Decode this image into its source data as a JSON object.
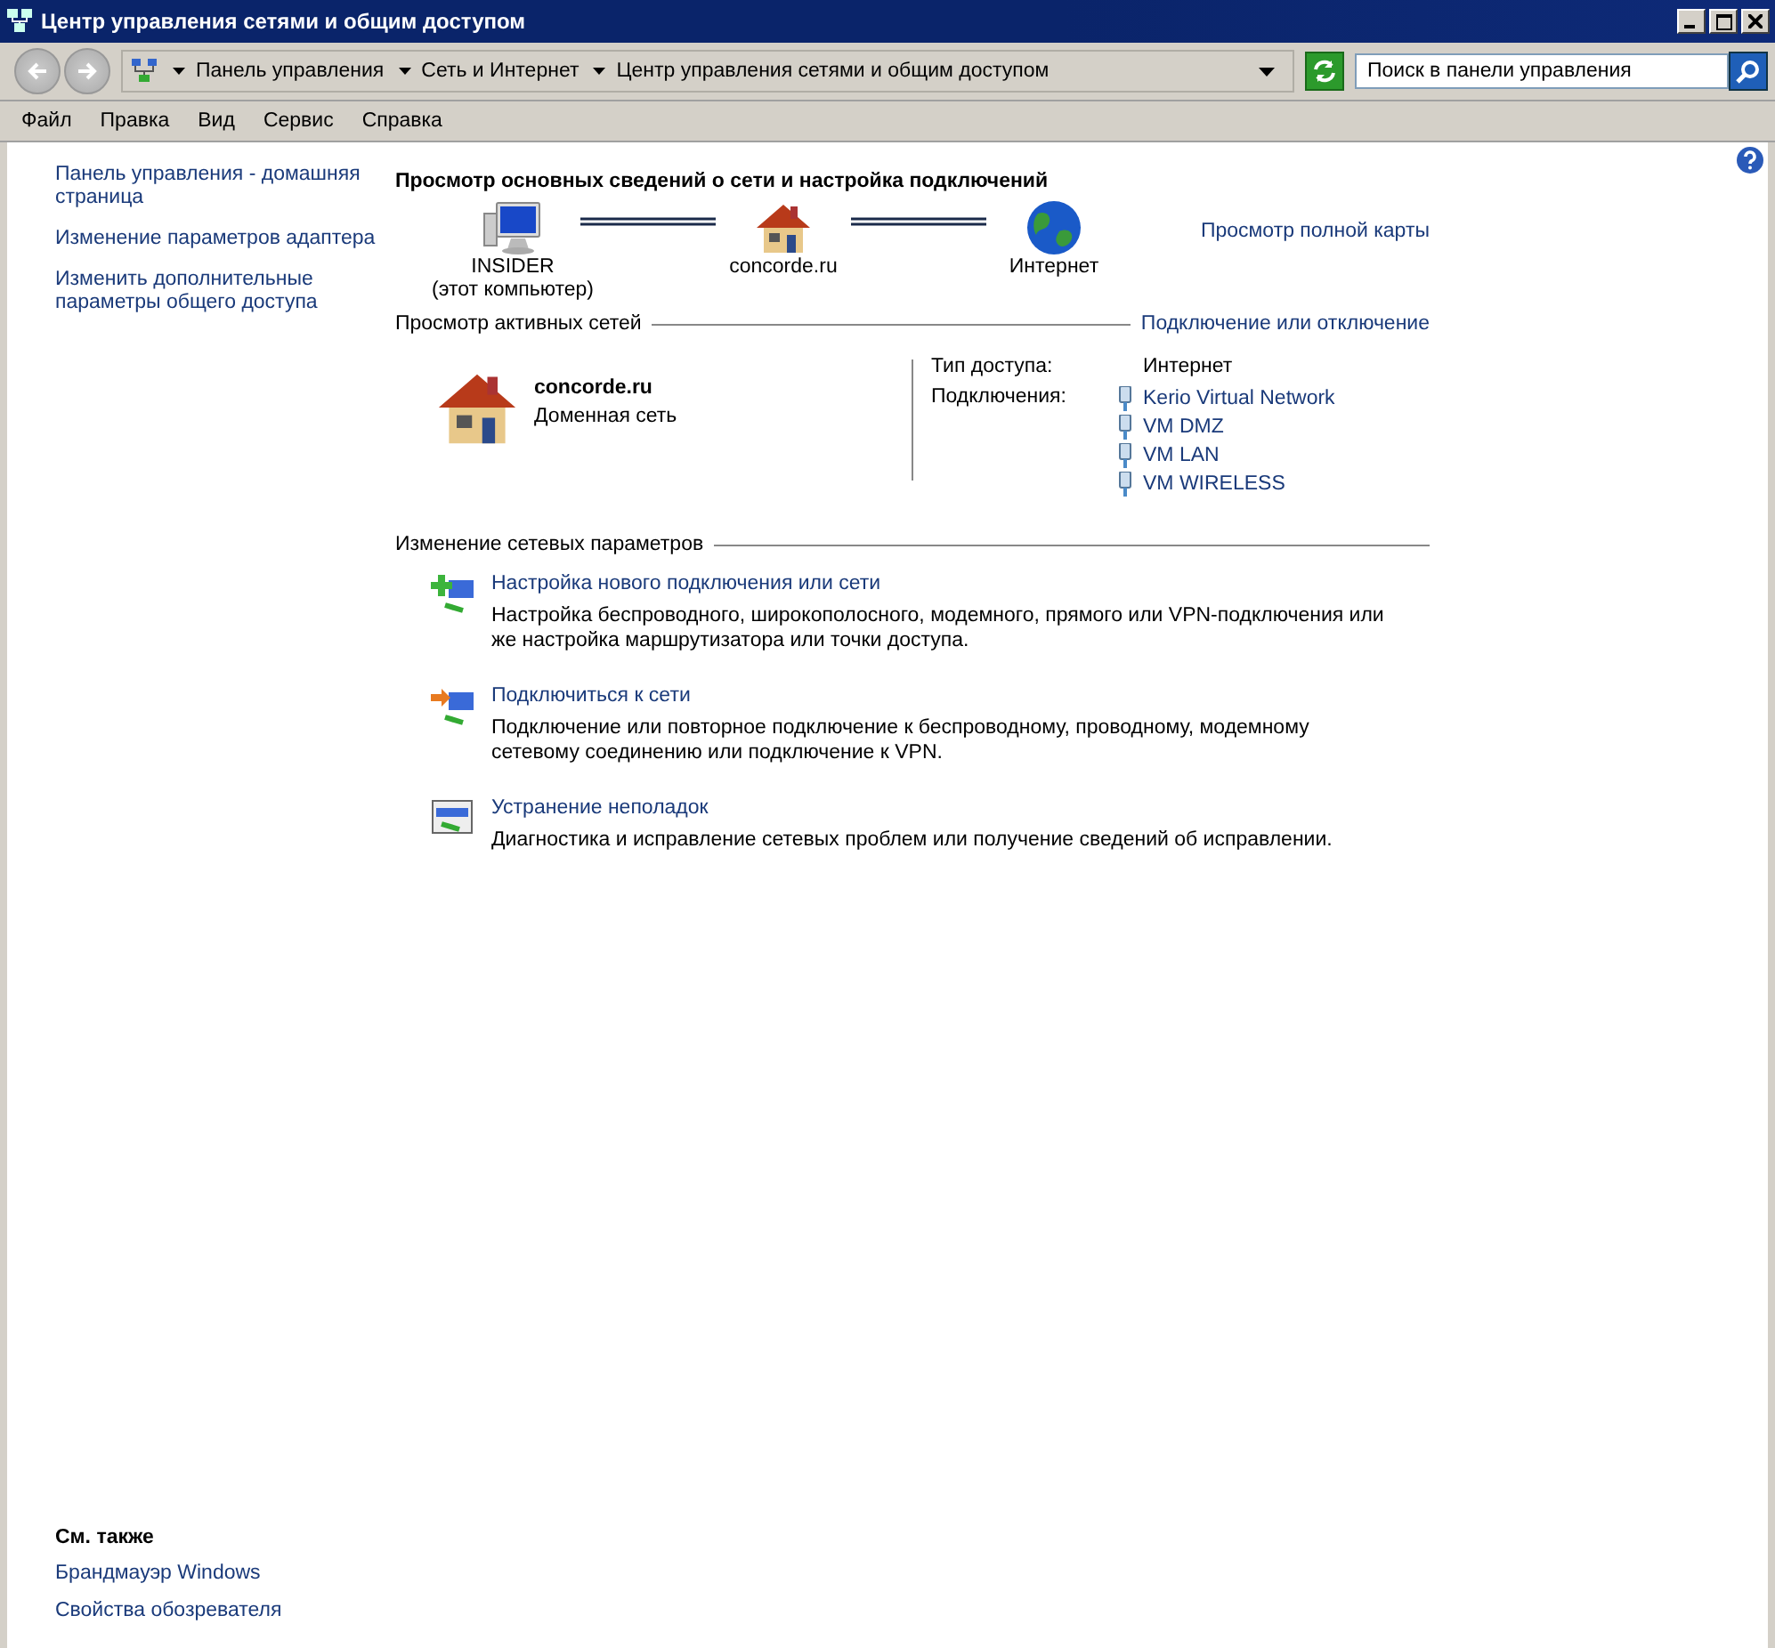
{
  "window": {
    "title": "Центр управления сетями и общим доступом"
  },
  "address_bar": {
    "breadcrumbs": [
      "Панель управления",
      "Сеть и Интернет",
      "Центр управления сетями и общим доступом"
    ],
    "search": {
      "placeholder": "Поиск в панели управления"
    }
  },
  "menu": [
    "Файл",
    "Правка",
    "Вид",
    "Сервис",
    "Справка"
  ],
  "sidebar": {
    "links": [
      "Панель управления - домашняя страница",
      "Изменение параметров адаптера",
      "Изменить дополнительные параметры общего доступа"
    ],
    "see_also": {
      "heading": "См. также",
      "links": [
        "Брандмауэр Windows",
        "Свойства обозревателя"
      ]
    }
  },
  "main": {
    "heading": "Просмотр основных сведений о сети и настройка подключений",
    "map": {
      "nodes": [
        {
          "kind": "computer",
          "label": "INSIDER",
          "sublabel": "(этот компьютер)"
        },
        {
          "kind": "house",
          "label": "concorde.ru"
        },
        {
          "kind": "globe",
          "label": "Интернет"
        }
      ],
      "full_map_link": "Просмотр полной карты"
    },
    "active_networks": {
      "heading": "Просмотр активных сетей",
      "link": "Подключение или отключение",
      "name": "concorde.ru",
      "type": "Доменная сеть",
      "access_label": "Тип доступа:",
      "access_value": "Интернет",
      "connections_label": "Подключения:",
      "connections": [
        "Kerio Virtual Network",
        "VM DMZ",
        "VM LAN",
        "VM WIRELESS"
      ]
    },
    "settings": {
      "heading": "Изменение сетевых параметров",
      "actions": [
        {
          "kind": "new-connection",
          "title": "Настройка нового подключения или сети",
          "description": "Настройка беспроводного, широкополосного, модемного, прямого или VPN-подключения или же настройка маршрутизатора или точки доступа."
        },
        {
          "kind": "connect",
          "title": "Подключиться к сети",
          "description": "Подключение или повторное подключение к беспроводному, проводному, модемному сетевому соединению или подключение к VPN."
        },
        {
          "kind": "troubleshoot",
          "title": "Устранение неполадок",
          "description": "Диагностика и исправление сетевых проблем или получение сведений об исправлении."
        }
      ]
    }
  }
}
